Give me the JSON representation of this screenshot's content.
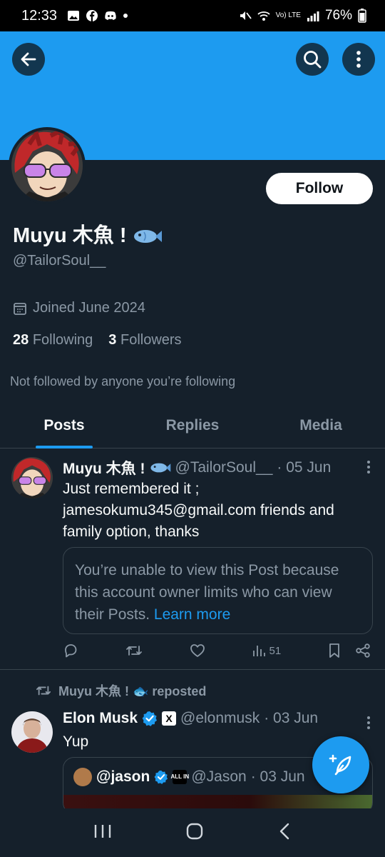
{
  "status_bar": {
    "time": "12:33",
    "battery": "76%",
    "network": "Vo) LTE"
  },
  "profile": {
    "name": "Muyu 木魚 !",
    "handle": "@TailorSoul__",
    "joined": "Joined June 2024",
    "following_count": "28",
    "following_label": "Following",
    "followers_count": "3",
    "followers_label": "Followers",
    "not_followed": "Not followed by anyone you’re following",
    "follow_label": "Follow"
  },
  "tabs": [
    {
      "label": "Posts",
      "active": true
    },
    {
      "label": "Replies",
      "active": false
    },
    {
      "label": "Media",
      "active": false
    }
  ],
  "post1": {
    "author": "Muyu 木魚 !",
    "handle": "@TailorSoul__",
    "date": "· 05 Jun",
    "text": "Just remembered it ; jamesokumu345@gmail.com friends and family option, thanks",
    "restricted_text": "You’re unable to view this Post because this account owner limits who can view their Posts.",
    "learn_more": "Learn more",
    "views": "51"
  },
  "repost_note": "Muyu 木魚 ! 🐟 reposted",
  "post2": {
    "author": "Elon Musk",
    "handle": "@elonmusk",
    "date": "· 03 Jun",
    "text": "Yup",
    "x_badge": "X",
    "quote": {
      "author": "@jason",
      "handle": "@Jason",
      "date": "· 03 Jun",
      "badge": "ALL IN"
    }
  },
  "colors": {
    "accent": "#1d9bf0",
    "background": "#15202b",
    "muted": "#8b98a5"
  }
}
